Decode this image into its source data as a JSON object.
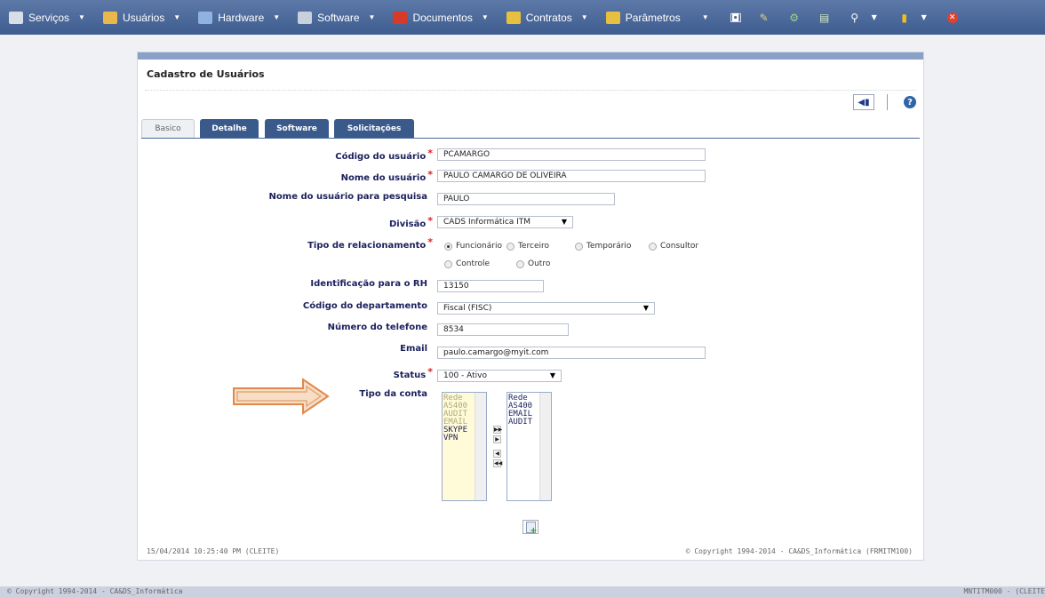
{
  "menu": {
    "items": [
      {
        "label": "Serviços",
        "icon": "services-icon",
        "color": "#d8dee8"
      },
      {
        "label": "Usuários",
        "icon": "users-icon",
        "color": "#e8b84a"
      },
      {
        "label": "Hardware",
        "icon": "hardware-icon",
        "color": "#8fb2e0"
      },
      {
        "label": "Software",
        "icon": "software-icon",
        "color": "#c8d0dc"
      },
      {
        "label": "Documentos",
        "icon": "documents-icon",
        "color": "#d83a2a"
      },
      {
        "label": "Contratos",
        "icon": "contracts-icon",
        "color": "#e8c040"
      },
      {
        "label": "Parâmetros",
        "icon": "parameters-icon",
        "color": "#e8c040"
      }
    ]
  },
  "page": {
    "title": "Cadastro de Usuários",
    "help": "?"
  },
  "tabs": [
    "Basico",
    "Detalhe",
    "Software",
    "Solicitações"
  ],
  "form": {
    "codigo_label": "Código do usuário",
    "codigo_value": "PCAMARGO",
    "nome_label": "Nome do usuário",
    "nome_value": "PAULO CAMARGO DE OLIVEIRA",
    "pesquisa_label": "Nome do usuário para pesquisa",
    "pesquisa_value": "PAULO",
    "divisao_label": "Divisão",
    "divisao_value": "CADS Informática ITM",
    "tipo_label": "Tipo de relacionamento",
    "radios": [
      "Funcionário",
      "Terceiro",
      "Temporário",
      "Consultor",
      "Controle",
      "Outro"
    ],
    "selected_radio": "Funcionário",
    "rh_label": "Identificação para o RH",
    "rh_value": "13150",
    "departamento_label": "Código do departamento",
    "departamento_value": "Fiscal (FISC)",
    "telefone_label": "Número do telefone",
    "telefone_value": "8534",
    "email_label": "Email",
    "email_value": "paulo.camargo@myit.com",
    "status_label": "Status",
    "status_value": "100 - Ativo",
    "conta_label": "Tipo da conta",
    "available": [
      "Rede",
      "AS400",
      "AUDIT",
      "EMAIL",
      "SKYPE",
      "VPN"
    ],
    "selected": [
      "Rede",
      "AS400",
      "EMAIL",
      "AUDIT"
    ]
  },
  "footer": {
    "timestamp": "15/04/2014  10:25:40 PM (CLEITE)",
    "copyright": "© Copyright 1994-2014 - CA&DS_Informática (FRMITM100)"
  },
  "bottom": {
    "left": "© Copyright 1994-2014 - CA&DS_Informática",
    "right": "MNTITM000 - (CLEITE"
  }
}
